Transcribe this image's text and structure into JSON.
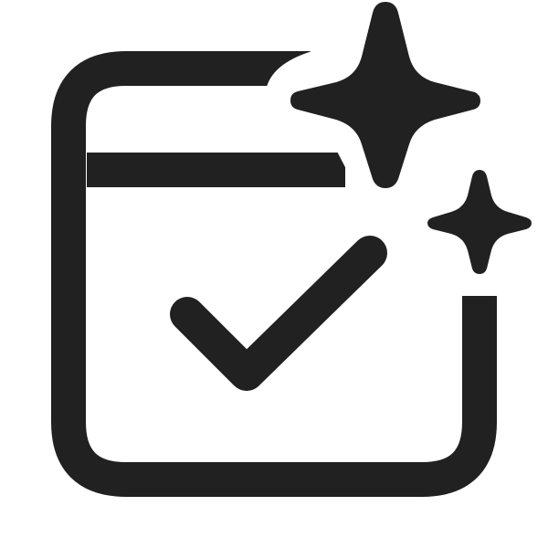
{
  "icon": {
    "name": "calendar-checkmark-sparkle-icon",
    "color": "#212121",
    "background": "#ffffff"
  }
}
